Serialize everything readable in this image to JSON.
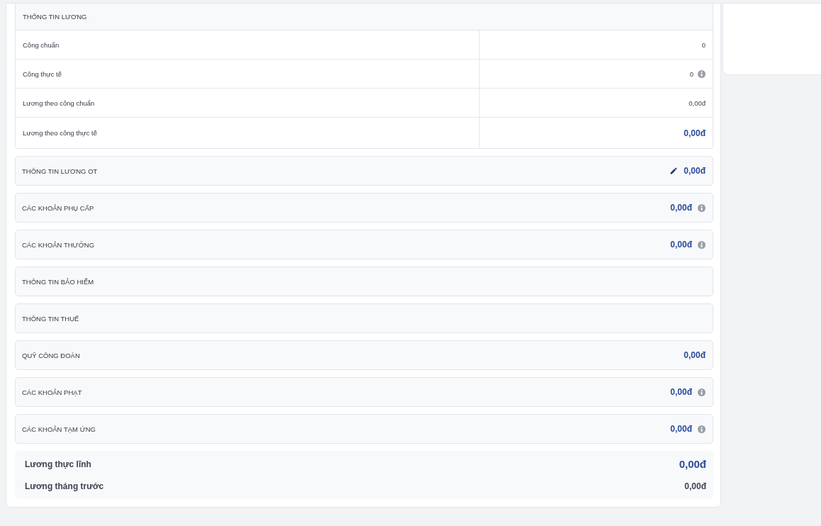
{
  "salary_table": {
    "title": "THÔNG TIN LƯƠNG",
    "rows": [
      {
        "label": "Công chuẩn",
        "value": "0",
        "kind": "plain",
        "info": false
      },
      {
        "label": "Công thực tế",
        "value": "0",
        "kind": "plain",
        "info": true
      },
      {
        "label": "Lương theo công chuẩn",
        "value": "0,00đ",
        "kind": "plain",
        "info": false
      },
      {
        "label": "Lương theo công thực tế",
        "value": "0,00đ",
        "kind": "total",
        "info": false
      }
    ]
  },
  "sections": [
    {
      "title": "THÔNG TIN LƯƠNG OT",
      "value": "0,00đ",
      "kind": "edit"
    },
    {
      "title": "CÁC KHOẢN PHỤ CẤP",
      "value": "0,00đ",
      "kind": "info"
    },
    {
      "title": "CÁC KHOẢN THƯỞNG",
      "value": "0,00đ",
      "kind": "info"
    },
    {
      "title": "THÔNG TIN BẢO HIỂM",
      "kind": "none"
    },
    {
      "title": "THÔNG TIN THUẾ",
      "kind": "none"
    },
    {
      "title": "QUỸ CÔNG ĐOÀN",
      "value": "0,00đ",
      "kind": "value"
    },
    {
      "title": "CÁC KHOẢN PHẠT",
      "value": "0,00đ",
      "kind": "info"
    },
    {
      "title": "CÁC KHOẢN TẠM ỨNG",
      "value": "0,00đ",
      "kind": "info"
    }
  ],
  "summary": [
    {
      "label": "Lương thực lĩnh",
      "value": "0,00đ",
      "kind": "main"
    },
    {
      "label": "Lương tháng trước",
      "value": "0,00đ",
      "kind": "secondary"
    }
  ]
}
